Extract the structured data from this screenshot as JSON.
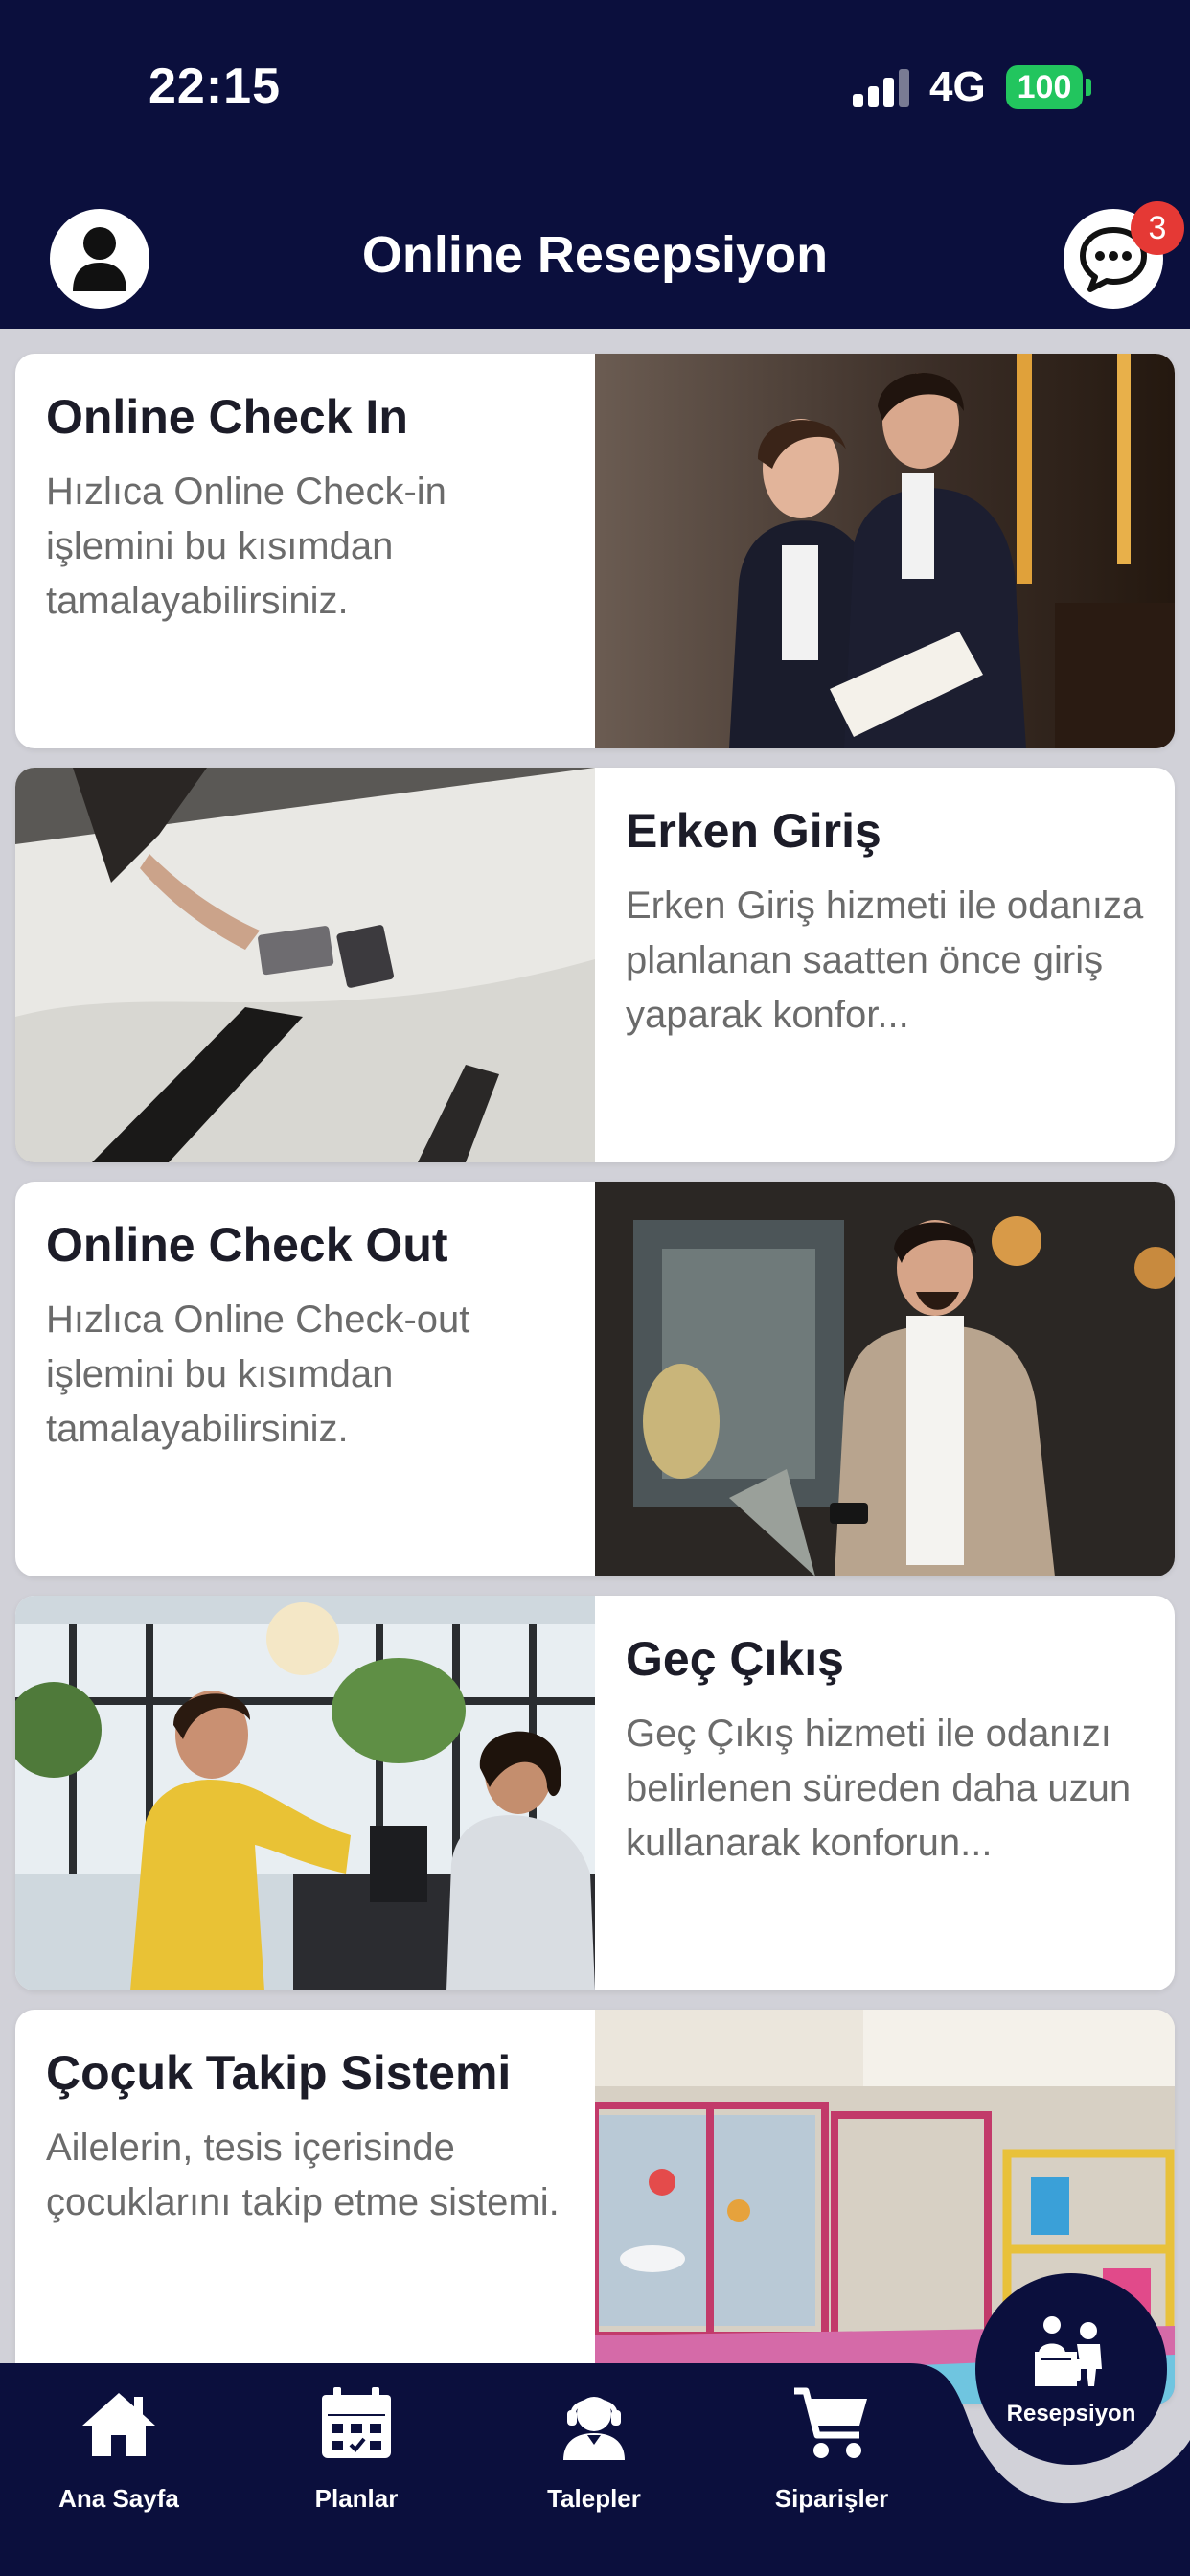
{
  "status_bar": {
    "time": "22:15",
    "network": "4G",
    "battery": "100"
  },
  "header": {
    "title": "Online Resepsiyon",
    "notification_count": "3"
  },
  "cards": [
    {
      "title": "Online Check In",
      "description": "Hızlıca Online Check-in işlemini bu kısımdan tamalayabilirsiniz."
    },
    {
      "title": "Erken Giriş",
      "description": "Erken Giriş hizmeti ile odanıza planlanan saatten önce giriş yaparak konfor..."
    },
    {
      "title": "Online Check Out",
      "description": "Hızlıca Online Check-out işlemini bu kısımdan tamalayabilirsiniz."
    },
    {
      "title": "Geç Çıkış",
      "description": "Geç Çıkış hizmeti ile odanızı belirlenen süreden daha uzun kullanarak konforun..."
    },
    {
      "title": "Çoçuk Takip Sistemi",
      "description": "Ailelerin, tesis içerisinde çocuklarını takip etme sistemi."
    }
  ],
  "bottom_nav": {
    "items": [
      {
        "label": "Ana Sayfa",
        "icon": "home-icon"
      },
      {
        "label": "Planlar",
        "icon": "calendar-icon"
      },
      {
        "label": "Talepler",
        "icon": "support-agent-icon"
      },
      {
        "label": "Siparişler",
        "icon": "cart-icon"
      }
    ],
    "active": {
      "label": "Resepsiyon",
      "icon": "reception-icon"
    }
  },
  "colors": {
    "navy": "#0b0f3d",
    "page_bg": "#d1d1d8",
    "badge": "#e53935",
    "battery": "#22c55e"
  }
}
